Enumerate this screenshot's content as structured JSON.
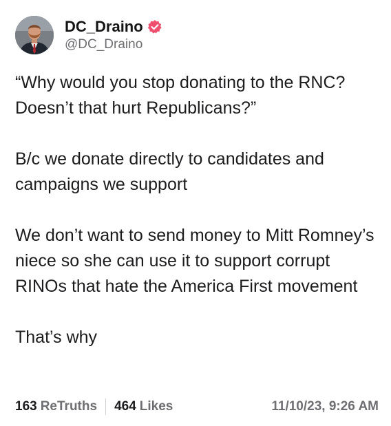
{
  "author": {
    "display_name": "DC_Draino",
    "handle": "@DC_Draino",
    "verified": true,
    "verified_color": "#f0506e",
    "avatar_icon": "user-avatar"
  },
  "post": {
    "paragraphs": [
      "“Why would you stop donating to the RNC? Doesn’t that hurt Republicans?”",
      "B/c we donate directly to candidates and campaigns we support",
      "We don’t want to send money to Mitt Romney’s niece so she can use it to support corrupt RINOs that hate the America First movement",
      "That’s why"
    ]
  },
  "stats": {
    "retruths_count": "163",
    "retruths_label": "ReTruths",
    "likes_count": "464",
    "likes_label": "Likes",
    "timestamp": "11/10/23, 9:26 AM"
  }
}
